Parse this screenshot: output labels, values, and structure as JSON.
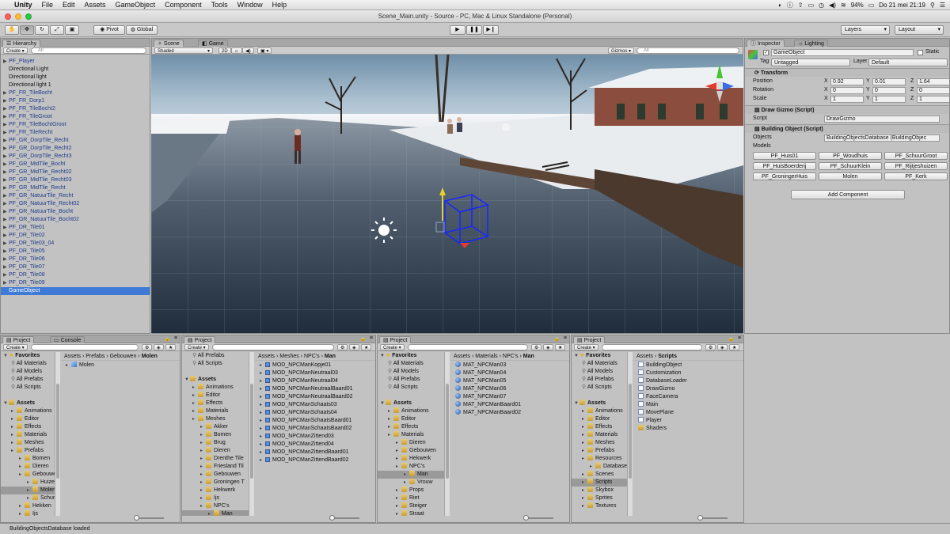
{
  "menubar": {
    "apple": "",
    "app": "Unity",
    "items": [
      "File",
      "Edit",
      "Assets",
      "GameObject",
      "Component",
      "Tools",
      "Window",
      "Help"
    ],
    "battery": "94%",
    "clock": "Do 21 mei  21:19"
  },
  "window": {
    "title": "Scene_Main.unity - Source - PC, Mac & Linux Standalone (Personal)"
  },
  "toolbar": {
    "pivot": "Pivot",
    "global": "Global",
    "layers": "Layers",
    "layout": "Layout"
  },
  "hierarchy": {
    "tab": "Hierarchy",
    "create": "Create",
    "search_placeholder": "All",
    "items": [
      {
        "label": "PF_Player",
        "prefab": true,
        "arrow": true
      },
      {
        "label": "Directional Light",
        "prefab": false,
        "arrow": false
      },
      {
        "label": "Directional light",
        "prefab": false,
        "arrow": false
      },
      {
        "label": "Directional light 1",
        "prefab": false,
        "arrow": false
      },
      {
        "label": "PF_FR_TileBocht",
        "prefab": true,
        "arrow": true
      },
      {
        "label": "PF_FR_Dorp1",
        "prefab": true,
        "arrow": true
      },
      {
        "label": "PF_FR_TileBocht2",
        "prefab": true,
        "arrow": true
      },
      {
        "label": "PF_FR_TileGroot",
        "prefab": true,
        "arrow": true
      },
      {
        "label": "PF_FR_TileBochtGroot",
        "prefab": true,
        "arrow": true
      },
      {
        "label": "PF_FR_TileRecht",
        "prefab": true,
        "arrow": true
      },
      {
        "label": "PF_GR_DorpTile_Recht",
        "prefab": true,
        "arrow": true
      },
      {
        "label": "PF_GR_DorpTile_Recht2",
        "prefab": true,
        "arrow": true
      },
      {
        "label": "PF_GR_DorpTile_Recht3",
        "prefab": true,
        "arrow": true
      },
      {
        "label": "PF_GR_MidTile_Bocht",
        "prefab": true,
        "arrow": true
      },
      {
        "label": "PF_GR_MidTile_Recht02",
        "prefab": true,
        "arrow": true
      },
      {
        "label": "PF_GR_MidTile_Recht03",
        "prefab": true,
        "arrow": true
      },
      {
        "label": "PF_GR_MidTile_Recht",
        "prefab": true,
        "arrow": true
      },
      {
        "label": "PF_GR_NatuurTile_Recht",
        "prefab": true,
        "arrow": true
      },
      {
        "label": "PF_GR_NatuurTile_Recht02",
        "prefab": true,
        "arrow": true
      },
      {
        "label": "PF_GR_NatuurTile_Bocht",
        "prefab": true,
        "arrow": true
      },
      {
        "label": "PF_GR_NatuurTile_Bocht02",
        "prefab": true,
        "arrow": true
      },
      {
        "label": "PF_DR_Tile01",
        "prefab": true,
        "arrow": true
      },
      {
        "label": "PF_DR_Tile02",
        "prefab": true,
        "arrow": true
      },
      {
        "label": "PF_DR_Tile03_04",
        "prefab": true,
        "arrow": true
      },
      {
        "label": "PF_DR_Tile05",
        "prefab": true,
        "arrow": true
      },
      {
        "label": "PF_DR_Tile06",
        "prefab": true,
        "arrow": true
      },
      {
        "label": "PF_DR_Tile07",
        "prefab": true,
        "arrow": true
      },
      {
        "label": "PF_DR_Tile08",
        "prefab": true,
        "arrow": true
      },
      {
        "label": "PF_DR_Tile09",
        "prefab": true,
        "arrow": true
      },
      {
        "label": "GameObject",
        "prefab": false,
        "arrow": false,
        "selected": true
      }
    ]
  },
  "scene": {
    "tab_scene": "Scene",
    "tab_game": "Game",
    "shading": "Shaded",
    "mode2d": "2D",
    "gizmos": "Gizmos",
    "search_placeholder": "All"
  },
  "inspector": {
    "tab": "Inspector",
    "tab2": "Lighting",
    "object_name": "GameObject",
    "static_label": "Static",
    "tag_label": "Tag",
    "tag_value": "Untagged",
    "layer_label": "Layer",
    "layer_value": "Default",
    "transform": {
      "title": "Transform",
      "position_label": "Position",
      "rotation_label": "Rotation",
      "scale_label": "Scale",
      "position": [
        "0.92",
        "0.01",
        "1.64"
      ],
      "rotation": [
        "0",
        "0",
        "0"
      ],
      "scale": [
        "1",
        "1",
        "1"
      ]
    },
    "draw_gizmo": {
      "title": "Draw Gizmo (Script)",
      "script_label": "Script",
      "script_value": "DrawGizmo"
    },
    "building_object": {
      "title": "Building Object (Script)",
      "objects_label": "Objects",
      "objects_value": "BuildingObjectsDatabase (BuildingObjec",
      "models_label": "Models",
      "models": [
        "PF_Huis01",
        "PF_Woudhuis",
        "PF_SchuurGroot",
        "PF_HuisBoerderij",
        "PF_SchuurKlein",
        "PF_Rijtjeshuizen",
        "PF_GroningerHuis",
        "Molen",
        "PF_Kerk"
      ]
    },
    "add_component": "Add Component",
    "axes": [
      "X",
      "Y",
      "Z"
    ]
  },
  "project1": {
    "tab": "Project",
    "tab2": "Console",
    "create": "Create",
    "tree": [
      {
        "label": "Favorites",
        "type": "fav",
        "indent": 0
      },
      {
        "label": "All Materials",
        "type": "search",
        "indent": 1
      },
      {
        "label": "All Models",
        "type": "search",
        "indent": 1
      },
      {
        "label": "All Prefabs",
        "type": "search",
        "indent": 1
      },
      {
        "label": "All Scripts",
        "type": "search",
        "indent": 1
      },
      {
        "label": "",
        "type": "blank",
        "indent": 0
      },
      {
        "label": "Assets",
        "type": "root",
        "indent": 0
      },
      {
        "label": "Animations",
        "type": "folder",
        "indent": 1
      },
      {
        "label": "Editor",
        "type": "folder",
        "indent": 1
      },
      {
        "label": "Effects",
        "type": "folder",
        "indent": 1
      },
      {
        "label": "Materials",
        "type": "folder",
        "indent": 1
      },
      {
        "label": "Meshes",
        "type": "folder",
        "indent": 1
      },
      {
        "label": "Prefabs",
        "type": "folder",
        "indent": 1
      },
      {
        "label": "Bomen",
        "type": "folder",
        "indent": 2
      },
      {
        "label": "Dieren",
        "type": "folder",
        "indent": 2
      },
      {
        "label": "Gebouwen",
        "type": "folder",
        "indent": 2
      },
      {
        "label": "Huizen",
        "type": "folder",
        "indent": 3
      },
      {
        "label": "Molen",
        "type": "folder",
        "indent": 3,
        "selected": true
      },
      {
        "label": "Schur",
        "type": "folder",
        "indent": 3
      },
      {
        "label": "Hekken",
        "type": "folder",
        "indent": 2
      },
      {
        "label": "Ijs",
        "type": "folder",
        "indent": 2
      }
    ],
    "breadcrumb": [
      "Assets",
      "Prefabs",
      "Gebouwen",
      "Molen"
    ],
    "files": [
      {
        "label": "Molen",
        "icon": "cube"
      }
    ]
  },
  "project2": {
    "tab": "Project",
    "create": "Create",
    "tree": [
      {
        "label": "All Prefabs",
        "type": "search",
        "indent": 1
      },
      {
        "label": "All Scripts",
        "type": "search",
        "indent": 1
      },
      {
        "label": "",
        "type": "blank",
        "indent": 0
      },
      {
        "label": "Assets",
        "type": "root",
        "indent": 0
      },
      {
        "label": "Animations",
        "type": "folder",
        "indent": 1
      },
      {
        "label": "Editor",
        "type": "folder",
        "indent": 1
      },
      {
        "label": "Effects",
        "type": "folder",
        "indent": 1
      },
      {
        "label": "Materials",
        "type": "folder",
        "indent": 1
      },
      {
        "label": "Meshes",
        "type": "folder",
        "indent": 1
      },
      {
        "label": "Akker",
        "type": "folder",
        "indent": 2
      },
      {
        "label": "Bomen",
        "type": "folder",
        "indent": 2
      },
      {
        "label": "Brug",
        "type": "folder",
        "indent": 2
      },
      {
        "label": "Dieren",
        "type": "folder",
        "indent": 2
      },
      {
        "label": "Drenthe Tile",
        "type": "folder",
        "indent": 2
      },
      {
        "label": "Friesland Til",
        "type": "folder",
        "indent": 2
      },
      {
        "label": "Gebouwen",
        "type": "folder",
        "indent": 2
      },
      {
        "label": "Groningen T",
        "type": "folder",
        "indent": 2
      },
      {
        "label": "Hekwerk",
        "type": "folder",
        "indent": 2
      },
      {
        "label": "Ijs",
        "type": "folder",
        "indent": 2
      },
      {
        "label": "NPC's",
        "type": "folder",
        "indent": 2
      },
      {
        "label": "Man",
        "type": "folder",
        "indent": 3,
        "selected": true
      }
    ],
    "breadcrumb": [
      "Assets",
      "Meshes",
      "NPC's",
      "Man"
    ],
    "files": [
      {
        "label": "MOD_NPCManKopje01",
        "icon": "mesh"
      },
      {
        "label": "MOD_NPCManNeutraal03",
        "icon": "mesh"
      },
      {
        "label": "MOD_NPCManNeutraal04",
        "icon": "mesh"
      },
      {
        "label": "MOD_NPCManNeutraalBaard01",
        "icon": "mesh"
      },
      {
        "label": "MOD_NPCManNeutraalBaard02",
        "icon": "mesh"
      },
      {
        "label": "MOD_NPCManSchaats03",
        "icon": "mesh"
      },
      {
        "label": "MOD_NPCManSchaats04",
        "icon": "mesh"
      },
      {
        "label": "MOD_NPCManSchaatsBaard01",
        "icon": "mesh"
      },
      {
        "label": "MOD_NPCManSchaatsBaard02",
        "icon": "mesh"
      },
      {
        "label": "MOD_NPCManZittend03",
        "icon": "mesh"
      },
      {
        "label": "MOD_NPCManZittend04",
        "icon": "mesh"
      },
      {
        "label": "MOD_NPCManZittendBaard01",
        "icon": "mesh"
      },
      {
        "label": "MOD_NPCManZittendBaard02",
        "icon": "mesh"
      }
    ]
  },
  "project3": {
    "tab": "Project",
    "create": "Create",
    "tree": [
      {
        "label": "Favorites",
        "type": "fav",
        "indent": 0
      },
      {
        "label": "All Materials",
        "type": "search",
        "indent": 1
      },
      {
        "label": "All Models",
        "type": "search",
        "indent": 1
      },
      {
        "label": "All Prefabs",
        "type": "search",
        "indent": 1
      },
      {
        "label": "All Scripts",
        "type": "search",
        "indent": 1
      },
      {
        "label": "",
        "type": "blank",
        "indent": 0
      },
      {
        "label": "Assets",
        "type": "root",
        "indent": 0
      },
      {
        "label": "Animations",
        "type": "folder",
        "indent": 1
      },
      {
        "label": "Editor",
        "type": "folder",
        "indent": 1
      },
      {
        "label": "Effects",
        "type": "folder",
        "indent": 1
      },
      {
        "label": "Materials",
        "type": "folder",
        "indent": 1
      },
      {
        "label": "Dieren",
        "type": "folder",
        "indent": 2
      },
      {
        "label": "Gebouwen",
        "type": "folder",
        "indent": 2
      },
      {
        "label": "Hekwerk",
        "type": "folder",
        "indent": 2
      },
      {
        "label": "NPC's",
        "type": "folder",
        "indent": 2
      },
      {
        "label": "Man",
        "type": "folder",
        "indent": 3,
        "selected": true
      },
      {
        "label": "Vrouw",
        "type": "folder",
        "indent": 3
      },
      {
        "label": "Props",
        "type": "folder",
        "indent": 2
      },
      {
        "label": "Riet",
        "type": "folder",
        "indent": 2
      },
      {
        "label": "Steiger",
        "type": "folder",
        "indent": 2
      },
      {
        "label": "Straat",
        "type": "folder",
        "indent": 2
      }
    ],
    "breadcrumb": [
      "Assets",
      "Materials",
      "NPC's",
      "Man"
    ],
    "files": [
      {
        "label": "MAT_NPCMan03",
        "icon": "sphere"
      },
      {
        "label": "MAT_NPCMan04",
        "icon": "sphere"
      },
      {
        "label": "MAT_NPCMan05",
        "icon": "sphere"
      },
      {
        "label": "MAT_NPCMan06",
        "icon": "sphere"
      },
      {
        "label": "MAT_NPCMan07",
        "icon": "sphere"
      },
      {
        "label": "MAT_NPCManBaard01",
        "icon": "sphere"
      },
      {
        "label": "MAT_NPCManBaard02",
        "icon": "sphere"
      }
    ]
  },
  "project4": {
    "tab": "Project",
    "create": "Create",
    "tree": [
      {
        "label": "Favorites",
        "type": "fav",
        "indent": 0
      },
      {
        "label": "All Materials",
        "type": "search",
        "indent": 1
      },
      {
        "label": "All Models",
        "type": "search",
        "indent": 1
      },
      {
        "label": "All Prefabs",
        "type": "search",
        "indent": 1
      },
      {
        "label": "All Scripts",
        "type": "search",
        "indent": 1
      },
      {
        "label": "",
        "type": "blank",
        "indent": 0
      },
      {
        "label": "Assets",
        "type": "root",
        "indent": 0
      },
      {
        "label": "Animations",
        "type": "folder",
        "indent": 1
      },
      {
        "label": "Editor",
        "type": "folder",
        "indent": 1
      },
      {
        "label": "Effects",
        "type": "folder",
        "indent": 1
      },
      {
        "label": "Materials",
        "type": "folder",
        "indent": 1
      },
      {
        "label": "Meshes",
        "type": "folder",
        "indent": 1
      },
      {
        "label": "Prefabs",
        "type": "folder",
        "indent": 1
      },
      {
        "label": "Resources",
        "type": "folder",
        "indent": 1
      },
      {
        "label": "Database",
        "type": "folder",
        "indent": 2
      },
      {
        "label": "Scenes",
        "type": "folder",
        "indent": 1
      },
      {
        "label": "Scripts",
        "type": "folder",
        "indent": 1,
        "selected": true
      },
      {
        "label": "Skybox",
        "type": "folder",
        "indent": 1
      },
      {
        "label": "Sprites",
        "type": "folder",
        "indent": 1
      },
      {
        "label": "Textures",
        "type": "folder",
        "indent": 1
      }
    ],
    "breadcrumb": [
      "Assets",
      "Scripts"
    ],
    "files": [
      {
        "label": "BuildingObject",
        "icon": "script"
      },
      {
        "label": "Customization",
        "icon": "script"
      },
      {
        "label": "DatabaseLoader",
        "icon": "script"
      },
      {
        "label": "DrawGizmo",
        "icon": "script"
      },
      {
        "label": "FaceCamera",
        "icon": "script"
      },
      {
        "label": "Main",
        "icon": "script"
      },
      {
        "label": "MovePlane",
        "icon": "script"
      },
      {
        "label": "Player",
        "icon": "script"
      },
      {
        "label": "Shaders",
        "icon": "folder"
      }
    ]
  },
  "status": {
    "message": "BuildingObjectsDatabase loaded"
  },
  "colors": {
    "selection": "#3e7ad6",
    "prefab_text": "#1f3d8a",
    "panel_bg": "#c2c2c2"
  }
}
